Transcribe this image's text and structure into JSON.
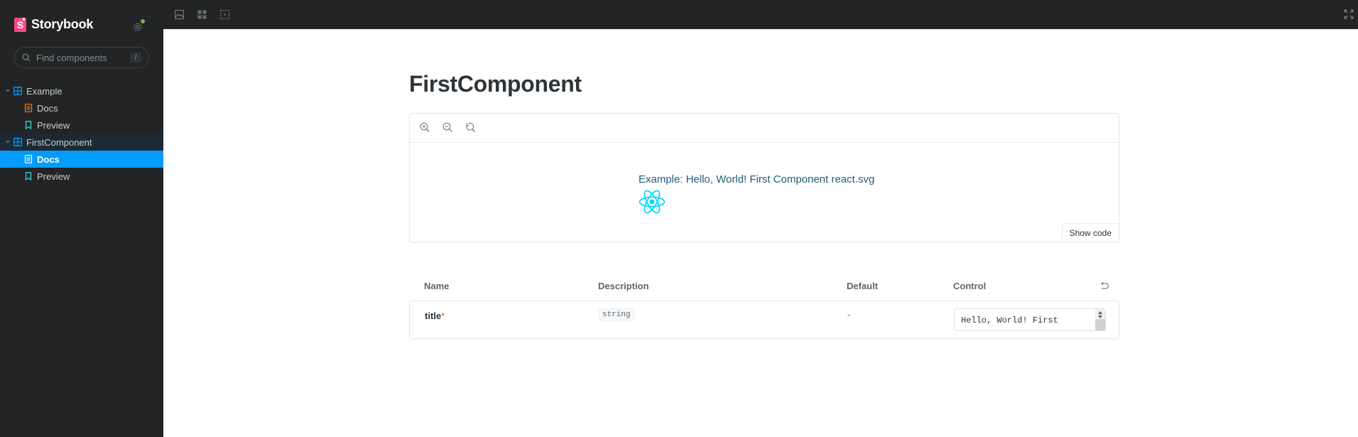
{
  "sidebar": {
    "brand": {
      "logo_letter": "S",
      "name": "Storybook"
    },
    "settings_icon": "gear-icon",
    "search": {
      "placeholder": "Find components",
      "shortcut": "/"
    },
    "tree": [
      {
        "type": "group",
        "label": "Example",
        "icon": "component-icon",
        "expanded": true
      },
      {
        "type": "leaf",
        "label": "Docs",
        "icon": "document-icon",
        "icon_color": "#ff8400"
      },
      {
        "type": "leaf",
        "label": "Preview",
        "icon": "bookmark-icon",
        "icon_color": "#37d5d3"
      },
      {
        "type": "group",
        "label": "FirstComponent",
        "icon": "component-icon",
        "expanded": true,
        "active": true
      },
      {
        "type": "leaf",
        "label": "Docs",
        "icon": "document-icon",
        "selected": true
      },
      {
        "type": "leaf",
        "label": "Preview",
        "icon": "bookmark-icon",
        "icon_color": "#37d5d3"
      }
    ]
  },
  "toolbar": {
    "buttons": [
      "image-icon",
      "grid-icon",
      "outline-icon"
    ],
    "fullscreen_icon": "fullscreen-icon"
  },
  "docs": {
    "title": "FirstComponent",
    "canvas": {
      "zoom_buttons": [
        "zoom-in-icon",
        "zoom-out-icon",
        "zoom-reset-icon"
      ],
      "story_text": "Example: Hello, World! First Component react.svg",
      "show_code_label": "Show code"
    },
    "args_table": {
      "headers": {
        "name": "Name",
        "description": "Description",
        "default": "Default",
        "control": "Control"
      },
      "rows": [
        {
          "name": "title",
          "required": "*",
          "type": "string",
          "default": "-",
          "control_value": "Hello, World! First"
        }
      ]
    }
  },
  "colors": {
    "sidebar_bg": "#222425",
    "selected_bg": "#029cfd",
    "brand": "#ff4785",
    "status_dot": "#66bf3c",
    "story_text": "#1f5d78",
    "react": "#00d8ff"
  }
}
